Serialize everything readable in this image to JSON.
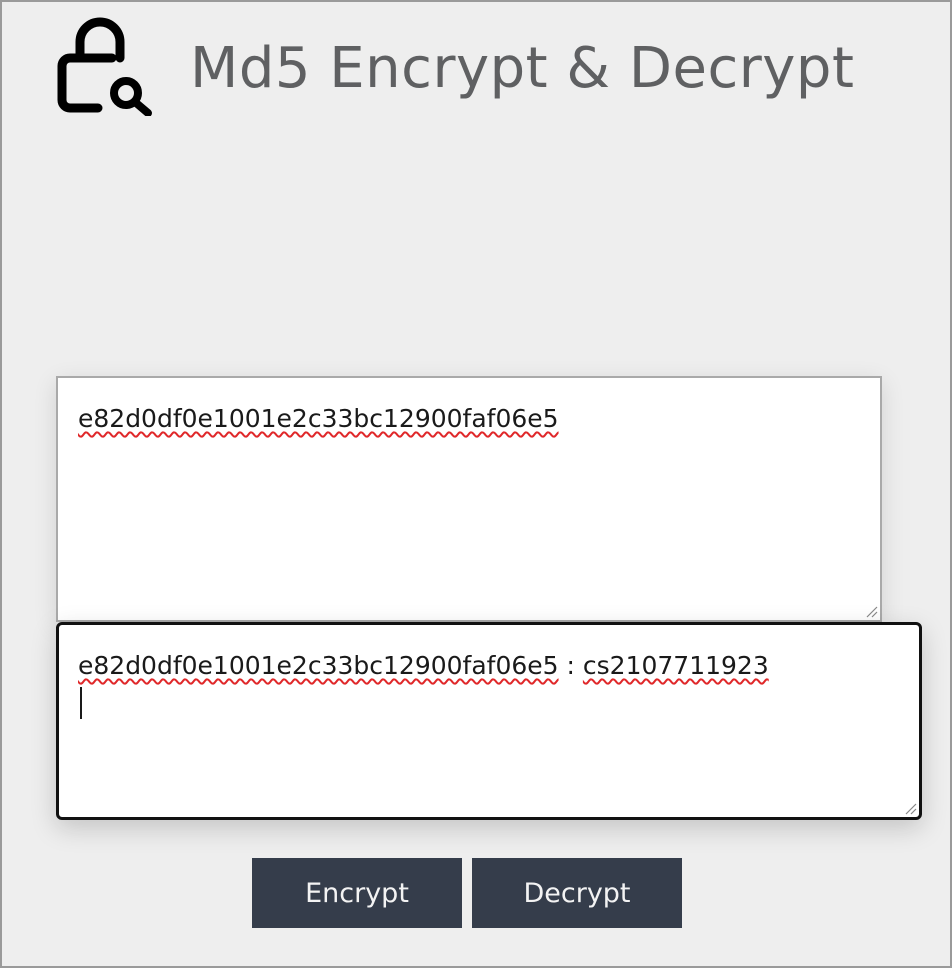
{
  "header": {
    "title": "Md5 Encrypt & Decrypt",
    "logo_icon": "lock-search-icon"
  },
  "input": {
    "value": "e82d0df0e1001e2c33bc12900faf06e5"
  },
  "output": {
    "hash": "e82d0df0e1001e2c33bc12900faf06e5",
    "separator": " : ",
    "plaintext": "cs2107711923"
  },
  "buttons": {
    "encrypt_label": "Encrypt",
    "decrypt_label": "Decrypt"
  },
  "colors": {
    "background": "#eeeeee",
    "title": "#5f6062",
    "button_bg": "#353d4b",
    "button_text": "#f3f3f3",
    "spellcheck": "#e0282a"
  }
}
